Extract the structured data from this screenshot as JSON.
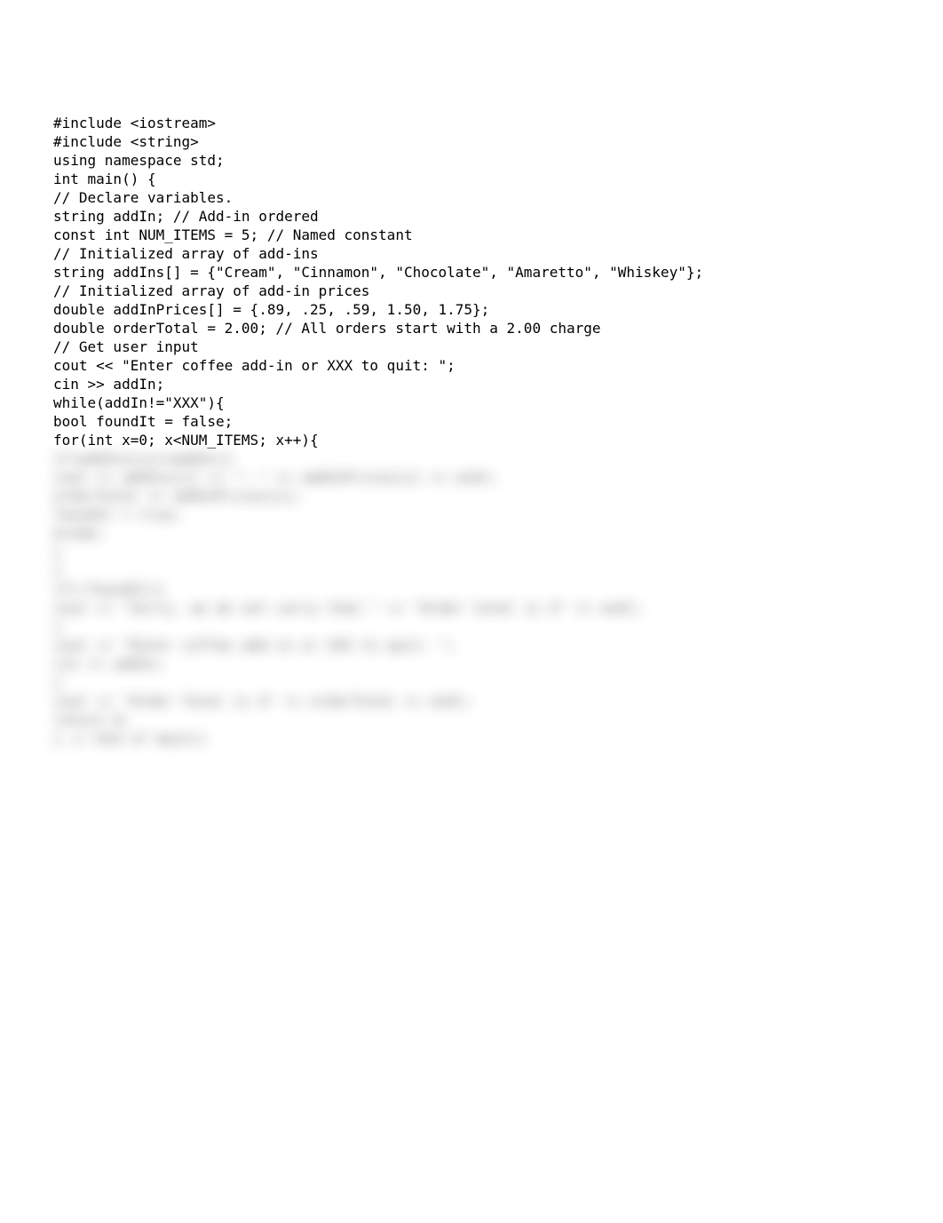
{
  "code": {
    "lines": [
      "#include <iostream>",
      "#include <string>",
      "using namespace std;",
      "int main() {",
      "// Declare variables.",
      "string addIn; // Add-in ordered",
      "const int NUM_ITEMS = 5; // Named constant",
      "// Initialized array of add-ins",
      "string addIns[] = {\"Cream\", \"Cinnamon\", \"Chocolate\", \"Amaretto\", \"Whiskey\"};",
      "// Initialized array of add-in prices",
      "double addInPrices[] = {.89, .25, .59, 1.50, 1.75};",
      "double orderTotal = 2.00; // All orders start with a 2.00 charge",
      "// Get user input",
      "cout << \"Enter coffee add-in or XXX to quit: \";",
      "cin >> addIn;",
      "while(addIn!=\"XXX\"){",
      "bool foundIt = false;",
      "for(int x=0; x<NUM_ITEMS; x++){"
    ]
  },
  "blurred": {
    "lines": [
      "if(addIns[x]==addIn){",
      "cout << addIns[x] << \": \" << addInPrices[x] << endl;",
      "orderTotal += addInPrices[x];",
      "foundIt = true;",
      "break;",
      "}",
      "}",
      "if(!foundIt){",
      "cout << \"Sorry, we do not carry that.\" << \"Order total is $\" << endl;",
      "}",
      "cout << \"Enter coffee add-in or XXX to quit: \";",
      "cin >> addIn;",
      "}",
      "cout << \"Order Total is $\" << orderTotal << endl;",
      "return 0;",
      "} // End of main()"
    ]
  }
}
